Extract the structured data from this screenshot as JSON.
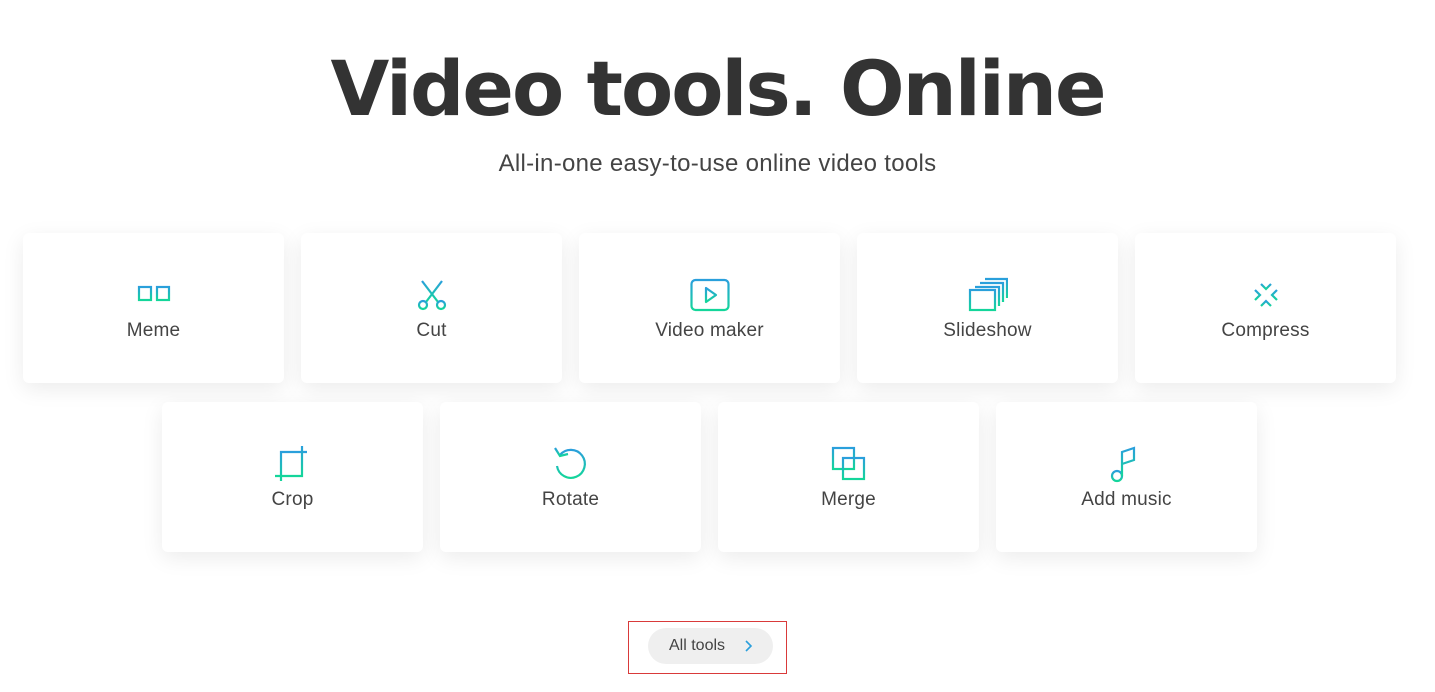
{
  "header": {
    "title": "Video tools. Online",
    "subtitle": "All-in-one easy-to-use online video tools"
  },
  "theme": {
    "icon_gradient_top": "#2a9fdc",
    "icon_gradient_bottom": "#14d69a",
    "text_color": "#333333",
    "button_bg": "#efefef",
    "chevron_color": "#2a9fdc",
    "highlight_border": "#d93a3a"
  },
  "tools": [
    {
      "label": "Meme",
      "icon": "glasses-icon"
    },
    {
      "label": "Cut",
      "icon": "scissors-icon"
    },
    {
      "label": "Video maker",
      "icon": "play-icon"
    },
    {
      "label": "Slideshow",
      "icon": "slides-icon"
    },
    {
      "label": "Compress",
      "icon": "compress-arrows-icon"
    },
    {
      "label": "Crop",
      "icon": "crop-icon"
    },
    {
      "label": "Rotate",
      "icon": "rotate-icon"
    },
    {
      "label": "Merge",
      "icon": "merge-icon"
    },
    {
      "label": "Add music",
      "icon": "add-music-icon"
    }
  ],
  "all_tools_button": {
    "label": "All tools",
    "icon": "chevron-right-icon"
  }
}
